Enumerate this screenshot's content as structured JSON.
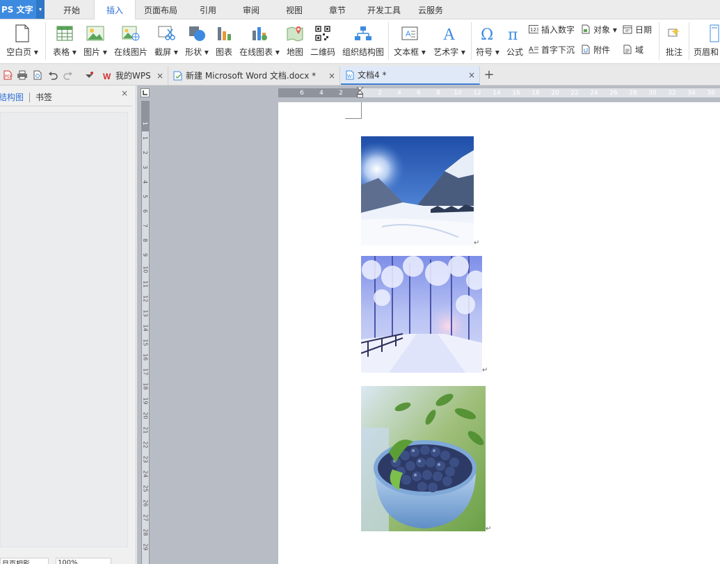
{
  "app": {
    "name": "PS 文字"
  },
  "menu": [
    {
      "label": "开始",
      "active": false
    },
    {
      "label": "插入",
      "active": true
    },
    {
      "label": "页面布局",
      "active": false
    },
    {
      "label": "引用",
      "active": false
    },
    {
      "label": "审阅",
      "active": false
    },
    {
      "label": "视图",
      "active": false
    },
    {
      "label": "章节",
      "active": false
    },
    {
      "label": "开发工具",
      "active": false
    },
    {
      "label": "云服务",
      "active": false
    }
  ],
  "ribbon": {
    "blank_page": "空白页 ▾",
    "table": "表格 ▾",
    "picture": "图片 ▾",
    "online_picture": "在线图片",
    "screenshot": "截屏 ▾",
    "shape": "形状 ▾",
    "chart": "图表",
    "online_chart": "在线图表 ▾",
    "map": "地图",
    "qrcode": "二维码",
    "org_chart": "组织结构图",
    "textbox": "文本框 ▾",
    "wordart": "艺术字 ▾",
    "symbol": "符号 ▾",
    "formula": "公式",
    "insert_number": "插入数字",
    "drop_cap": "首字下沉",
    "object": "对象 ▾",
    "attachment": "附件",
    "date": "日期",
    "field": "域",
    "comment": "批注",
    "header_footer": "页眉和"
  },
  "tabs": {
    "tab1": "我的WPS",
    "tab2": "新建 Microsoft Word 文档.docx *",
    "tab3": "文档4 *",
    "close": "×",
    "new": "+"
  },
  "left_panel": {
    "tab_structure": "结构图",
    "tab_bookmark": "书签",
    "close": "×"
  },
  "ruler": {
    "h_labels": [
      "6",
      "4",
      "2",
      "2",
      "4",
      "6",
      "8",
      "10",
      "12",
      "14",
      "16",
      "18",
      "20",
      "22",
      "24",
      "26",
      "28",
      "30",
      "32",
      "34",
      "36"
    ],
    "v_labels": [
      "1",
      "1",
      "2",
      "3",
      "4",
      "5",
      "6",
      "7",
      "8",
      "9",
      "10",
      "11",
      "12",
      "13",
      "14",
      "15",
      "16",
      "17",
      "18",
      "19",
      "20",
      "21",
      "22",
      "23",
      "24",
      "25",
      "26",
      "27",
      "28",
      "29"
    ]
  },
  "document": {
    "paragraph_mark": "↵",
    "images": [
      {
        "name": "snowy-mountain-image"
      },
      {
        "name": "snowy-forest-image"
      },
      {
        "name": "blueberries-image"
      }
    ]
  },
  "status": {
    "left_text": "目页相影",
    "zoom_text": "100%"
  },
  "colors": {
    "accent": "#3d8be0",
    "active_tab_text": "#2e6fd6"
  }
}
